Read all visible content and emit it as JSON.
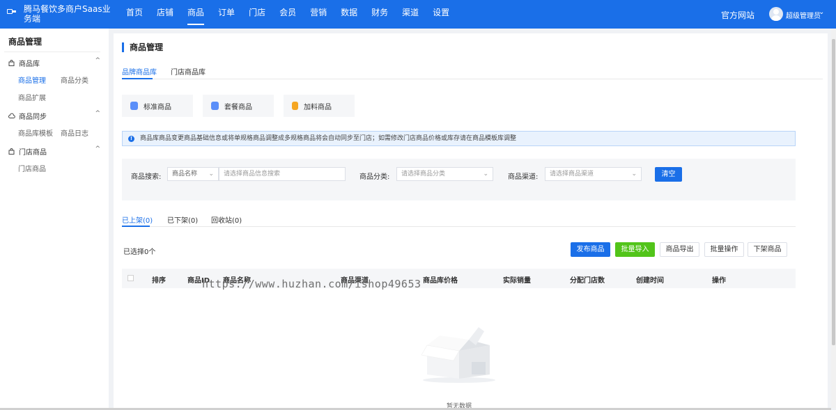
{
  "app": {
    "title": "腾马餐饮多商户Saas业务端",
    "logo_icon": "logo-icon"
  },
  "nav": {
    "items": [
      "首页",
      "店铺",
      "商品",
      "订单",
      "门店",
      "会员",
      "营销",
      "数据",
      "财务",
      "渠道",
      "设置"
    ],
    "active_index": 2,
    "official_site": "官方网站",
    "user_name": "超级管理员"
  },
  "sidebar": {
    "title": "商品管理",
    "groups": [
      {
        "label": "商品库",
        "icon": "bag-icon",
        "items": [
          "商品管理",
          "商品分类",
          "商品扩展"
        ]
      },
      {
        "label": "商品同步",
        "icon": "cloud-sync-icon",
        "items": [
          "商品库模板",
          "商品日志"
        ]
      },
      {
        "label": "门店商品",
        "icon": "store-icon",
        "items": [
          "门店商品"
        ]
      }
    ],
    "active_item": "商品管理"
  },
  "main": {
    "page_title": "商品管理",
    "library_tabs": [
      "品牌商品库",
      "门店商品库"
    ],
    "active_library_tab": 0,
    "type_cards": [
      {
        "label": "标准商品",
        "icon": "bag-icon",
        "color": "#5b8ff9"
      },
      {
        "label": "套餐商品",
        "icon": "bag-icon",
        "color": "#5b8ff9"
      },
      {
        "label": "加料商品",
        "icon": "bottle-icon",
        "color": "#f5a623"
      }
    ],
    "notice": "商品库商品变更商品基础信息或将单规格商品调整成多规格商品将会自动同步至门店；如需修改门店商品价格或库存请在商品模板库调整",
    "filter": {
      "search_label": "商品搜索:",
      "search_field_value": "商品名称",
      "search_placeholder": "请选择商品信息搜索",
      "category_label": "商品分类:",
      "category_placeholder": "请选择商品分类",
      "channel_label": "商品渠道:",
      "channel_placeholder": "请选择商品渠道",
      "clear_button": "清空"
    },
    "status_tabs": [
      "已上架(0)",
      "已下架(0)",
      "回收站(0)"
    ],
    "active_status_tab": 0,
    "selected_count": "已选择0个",
    "actions": {
      "publish": "发布商品",
      "batch_import": "批量导入",
      "export": "商品导出",
      "batch_ops": "批量操作",
      "delist": "下架商品"
    },
    "table_headers": [
      "排序",
      "商品ID",
      "商品名称",
      "商品渠道",
      "商品库价格",
      "实际销量",
      "分配门店数",
      "创建时间",
      "操作"
    ],
    "watermark": "https://www.huzhan.com/ishop49653",
    "empty_text": "暂无数据"
  },
  "colors": {
    "primary": "#1a6fe8",
    "success": "#52c41a",
    "notice_bg": "#e9f2fd"
  }
}
